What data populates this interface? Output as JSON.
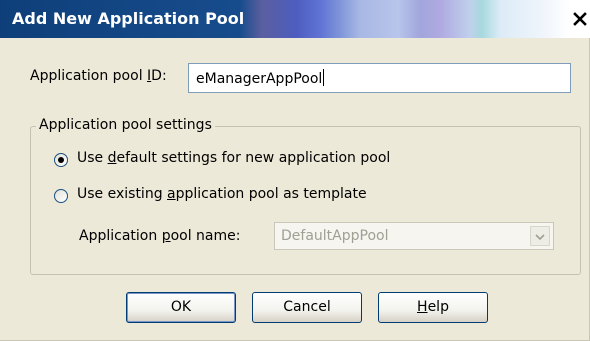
{
  "dialog": {
    "title": "Add New Application Pool",
    "close_glyph": "✕"
  },
  "pool_id": {
    "label_pre": "Application pool ",
    "label_key": "I",
    "label_post": "D:",
    "value": "eManagerAppPool"
  },
  "settings_group": {
    "legend": "Application pool settings",
    "option_default": {
      "pre": "Use ",
      "key": "d",
      "post": "efault settings for new application pool",
      "selected": true
    },
    "option_existing": {
      "pre": "Use existing ",
      "key": "a",
      "post": "pplication pool as template",
      "selected": false
    },
    "pool_name": {
      "label_pre": "Application ",
      "label_key": "p",
      "label_post": "ool name:",
      "value": "DefaultAppPool",
      "enabled": false
    }
  },
  "buttons": {
    "ok": "OK",
    "cancel": "Cancel",
    "help_key": "H",
    "help_rest": "elp"
  }
}
